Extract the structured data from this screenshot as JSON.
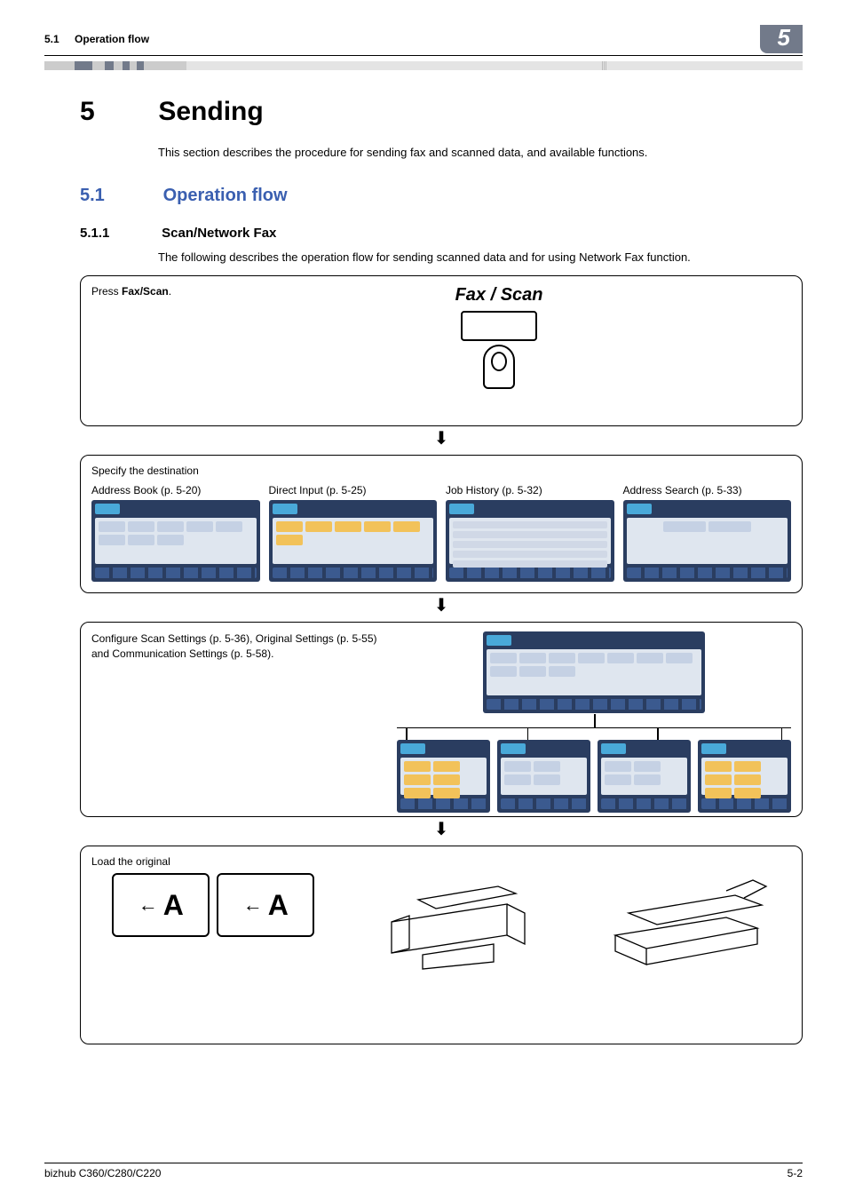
{
  "header": {
    "section_ref": "5.1",
    "section_name": "Operation flow",
    "chapter_badge": "5"
  },
  "chapter": {
    "number": "5",
    "title": "Sending",
    "intro": "This section describes the procedure for sending fax and scanned data, and available functions."
  },
  "section": {
    "number": "5.1",
    "title": "Operation flow"
  },
  "subsection": {
    "number": "5.1.1",
    "title": "Scan/Network Fax",
    "intro": "The following describes the operation flow for sending scanned data and for using Network Fax function."
  },
  "flow": {
    "step1": {
      "instruction_prefix": "Press ",
      "instruction_bold": "Fax/Scan",
      "instruction_suffix": ".",
      "panel_label": "Fax / Scan"
    },
    "step2": {
      "title": "Specify the destination",
      "cols": [
        "Address Book (p. 5-20)",
        "Direct Input (p. 5-25)",
        "Job History (p. 5-32)",
        "Address Search (p. 5-33)"
      ]
    },
    "step3": {
      "text": "Configure Scan Settings (p. 5-36), Original Settings (p. 5-55) and Communication Settings (p. 5-58)."
    },
    "step4": {
      "label": "Load the original",
      "glyph": "A"
    }
  },
  "footer": {
    "model": "bizhub C360/C280/C220",
    "page": "5-2"
  }
}
